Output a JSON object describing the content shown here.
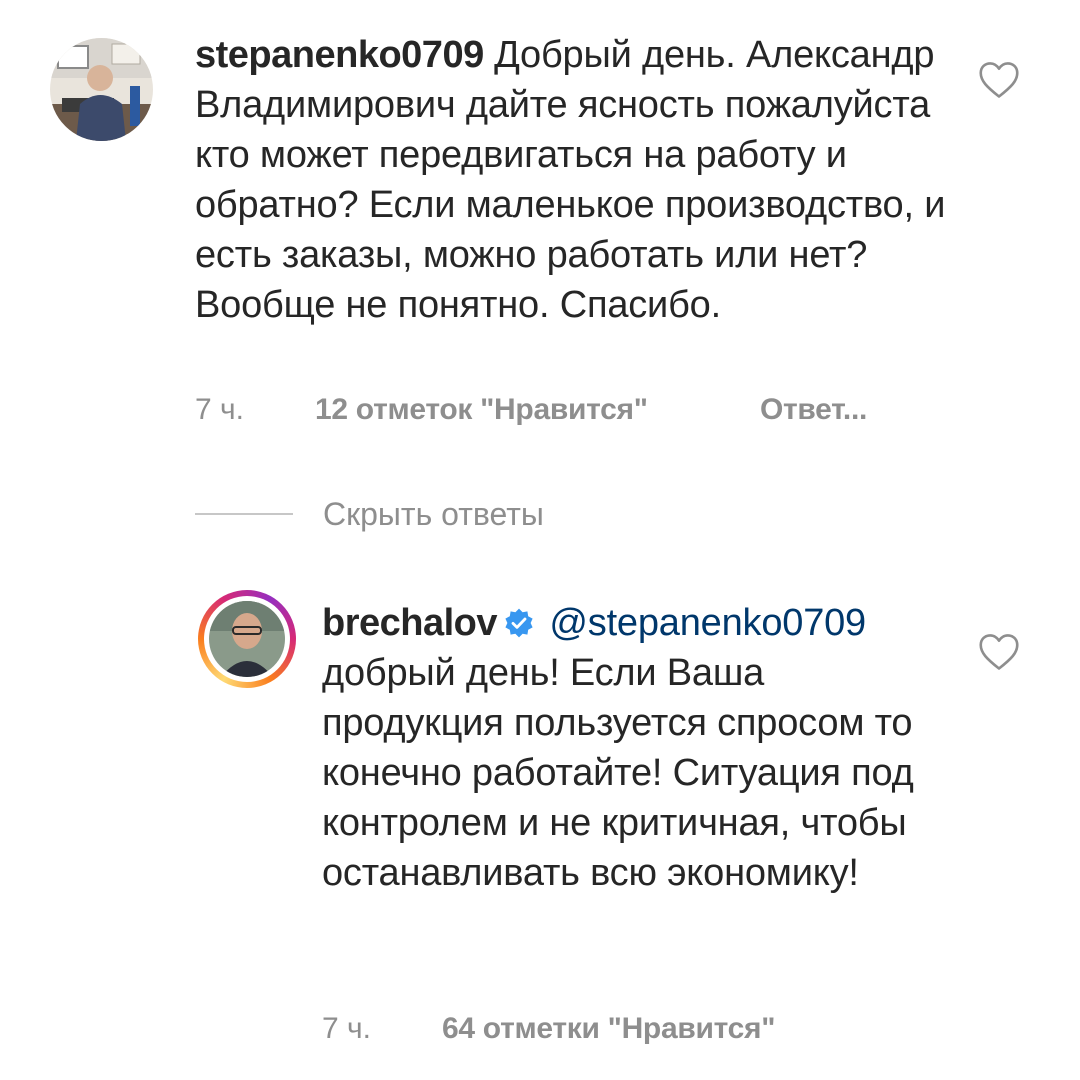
{
  "comments": [
    {
      "username": "stepanenko0709",
      "text": "Добрый день. Александр Владимирович дайте ясность пожалуйста кто может передвигаться на работу и обратно? Если маленькое производство, и есть заказы, можно работать или нет? Вообще не понятно. Спасибо.",
      "time": "7 ч.",
      "likes": "12 отметок \"Нравится\"",
      "reply_label": "Ответ..."
    }
  ],
  "replies_toggle": {
    "label": "Скрыть ответы"
  },
  "replies": [
    {
      "username": "brechalov",
      "verified": true,
      "mention": "@stepanenko0709",
      "text": "добрый день! Если Ваша продукция пользуется спросом то конечно работайте! Ситуация под контролем и не критичная, чтобы останавливать всю экономику!",
      "time": "7 ч.",
      "likes": "64 отметки \"Нравится\""
    }
  ],
  "icons": {
    "like": "heart-outline-icon",
    "verified": "verified-badge-icon"
  },
  "colors": {
    "text": "#262626",
    "meta": "#8e8e8e",
    "mention": "#00376b",
    "verified": "#3897f0"
  }
}
